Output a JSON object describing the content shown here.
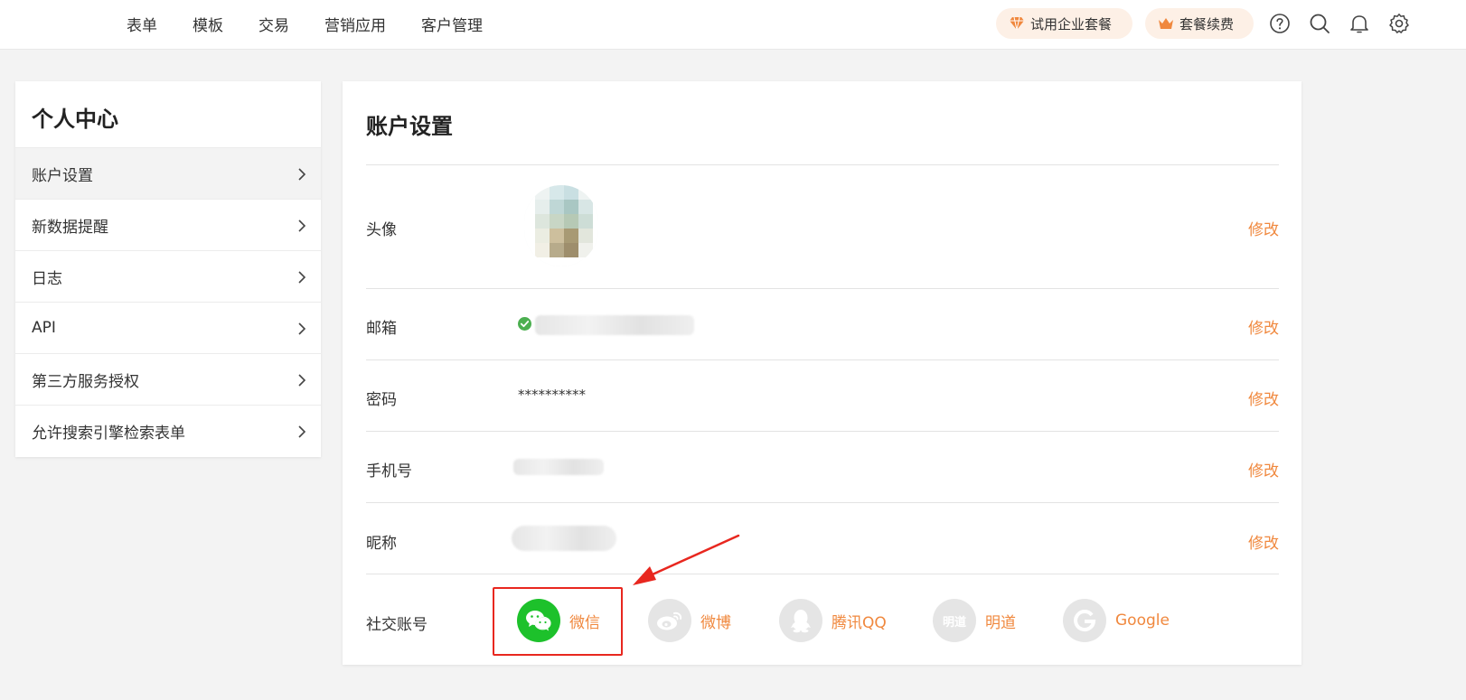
{
  "topnav": {
    "items": [
      "表单",
      "模板",
      "交易",
      "营销应用",
      "客户管理"
    ],
    "trial_label": "试用企业套餐",
    "renew_label": "套餐续费",
    "icons": [
      "help-icon",
      "search-icon",
      "bell-icon",
      "gear-icon"
    ]
  },
  "sidebar": {
    "title": "个人中心",
    "items": [
      {
        "label": "账户设置"
      },
      {
        "label": "新数据提醒"
      },
      {
        "label": "日志"
      },
      {
        "label": "API"
      },
      {
        "label": "第三方服务授权"
      },
      {
        "label": "允许搜索引擎检索表单"
      }
    ]
  },
  "main": {
    "title": "账户设置",
    "edit_label": "修改",
    "rows": {
      "avatar": "头像",
      "email": "邮箱",
      "password": "密码",
      "phone": "手机号",
      "nickname": "昵称",
      "social": "社交账号"
    },
    "password_mask": "**********",
    "social": [
      {
        "name": "微信",
        "icon": "wechat-icon"
      },
      {
        "name": "微博",
        "icon": "weibo-icon"
      },
      {
        "name": "腾讯QQ",
        "icon": "qq-icon"
      },
      {
        "name": "明道",
        "icon": "mingdao-icon"
      },
      {
        "name": "Google",
        "icon": "google-icon"
      }
    ],
    "mingdao_icon_text": "明道"
  },
  "colors": {
    "accent": "#f0883e",
    "wechat": "#1dc12b",
    "verified": "#4caf50",
    "highlight": "#e8271f"
  }
}
